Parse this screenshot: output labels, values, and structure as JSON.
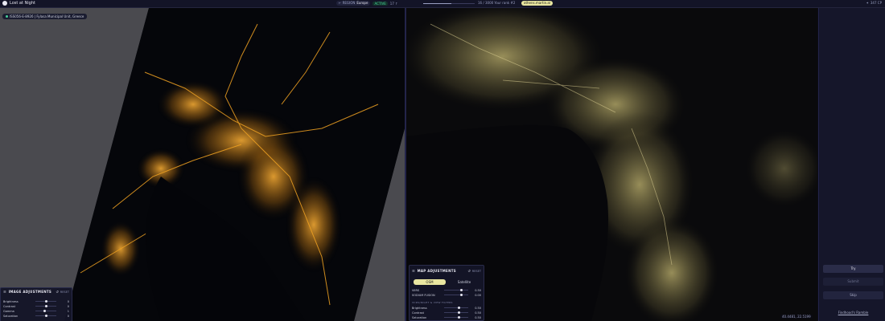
{
  "app": {
    "title": "Lost at Night"
  },
  "header": {
    "region_prefix": "← REGION",
    "region_name": "Europe",
    "active_badge": "ACTIVE",
    "sub_count": "17 ↑",
    "progress": 0.55,
    "counter": "16 / 3000 Your rank #2",
    "user": "athens.martin.al",
    "status_right": "347 CP"
  },
  "image": {
    "location": "ISS056-E-8926 | Fylasa Municipal Unit, Greece",
    "adjustments": {
      "title": "IMAGE ADJUSTMENTS",
      "reset": "RESET",
      "rows": [
        {
          "label": "Brightness",
          "value": "0",
          "pos": 0.5
        },
        {
          "label": "Contrast",
          "value": "0",
          "pos": 0.5
        },
        {
          "label": "Gamma",
          "value": "1",
          "pos": 0.45
        },
        {
          "label": "Saturation",
          "value": "0",
          "pos": 0.5
        }
      ]
    }
  },
  "map": {
    "adjustments": {
      "title": "MAP ADJUSTMENTS",
      "reset": "RESET",
      "mode_active": "OSM",
      "mode_other": "Satellite",
      "rows_top": [
        {
          "label": "VIIRS",
          "value": "0.50",
          "pos": 0.72
        },
        {
          "label": "SODIUM FUSION",
          "value": "0.00",
          "pos": 0.72
        }
      ],
      "section": "VIIRS/NIGHT & VIEW FILTERS",
      "rows_bottom": [
        {
          "label": "Brightness",
          "value": "0.50",
          "pos": 0.6
        },
        {
          "label": "Contrast",
          "value": "0.50",
          "pos": 0.6
        },
        {
          "label": "Saturation",
          "value": "0.50",
          "pos": 0.6
        }
      ]
    },
    "coords": "40.4481, 22.5199"
  },
  "sidebar": {
    "try_label": "Try",
    "submit_label": "Submit",
    "skip_label": "Skip",
    "link": "Findhood's Ramble"
  },
  "colors": {
    "accent": "#e9e6a0",
    "live": "#46d09a"
  }
}
